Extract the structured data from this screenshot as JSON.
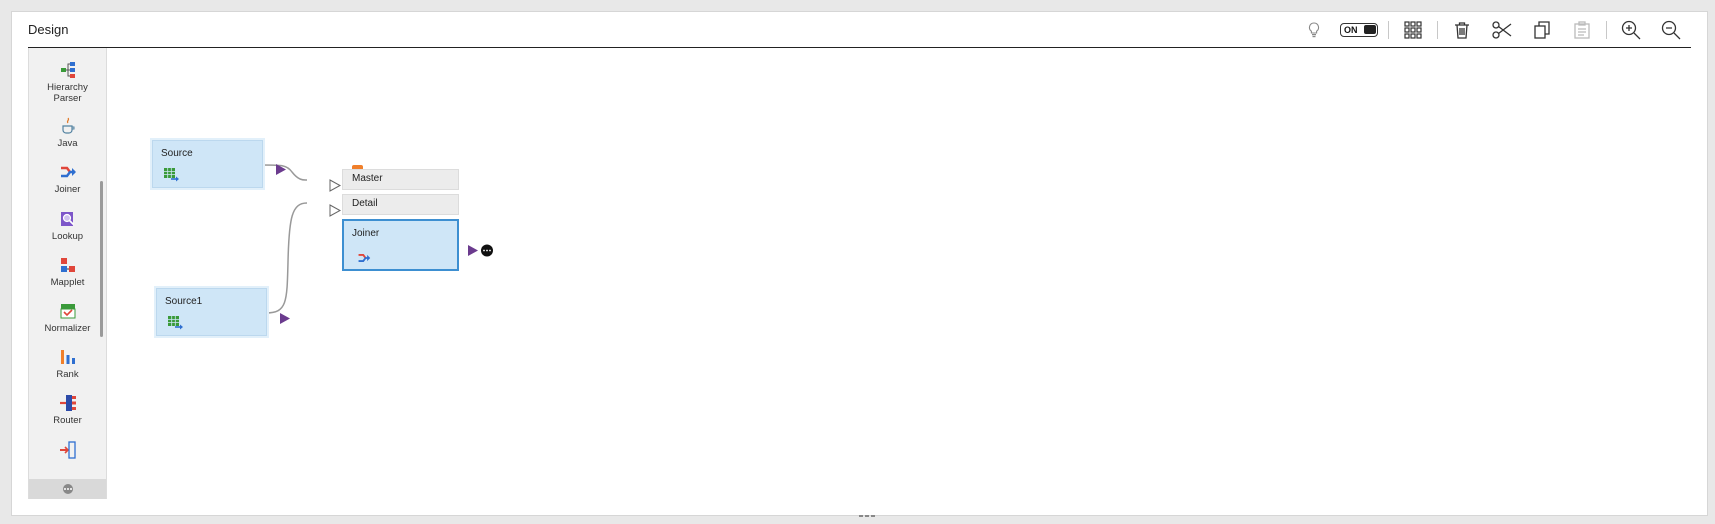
{
  "header": {
    "title": "Design"
  },
  "toolbar": {
    "toggle_label": "ON"
  },
  "palette": {
    "items": [
      {
        "label_line1": "Hierarchy",
        "label_line2": "Parser",
        "icon": "hierarchy-parser-icon"
      },
      {
        "label_line1": "Java",
        "label_line2": "",
        "icon": "java-icon"
      },
      {
        "label_line1": "Joiner",
        "label_line2": "",
        "icon": "joiner-icon"
      },
      {
        "label_line1": "Lookup",
        "label_line2": "",
        "icon": "lookup-icon"
      },
      {
        "label_line1": "Mapplet",
        "label_line2": "",
        "icon": "mapplet-icon"
      },
      {
        "label_line1": "Normalizer",
        "label_line2": "",
        "icon": "normalizer-icon"
      },
      {
        "label_line1": "Rank",
        "label_line2": "",
        "icon": "rank-icon"
      },
      {
        "label_line1": "Router",
        "label_line2": "",
        "icon": "router-icon"
      }
    ]
  },
  "canvas": {
    "source_label": "Source",
    "source1_label": "Source1",
    "joiner_label": "Joiner",
    "master_label": "Master",
    "detail_label": "Detail"
  },
  "colors": {
    "node_fill": "#cfe6f7",
    "selected_border": "#3d8fd1",
    "port_arrow": "#6b3b8e",
    "warning": "#f07f2a"
  }
}
